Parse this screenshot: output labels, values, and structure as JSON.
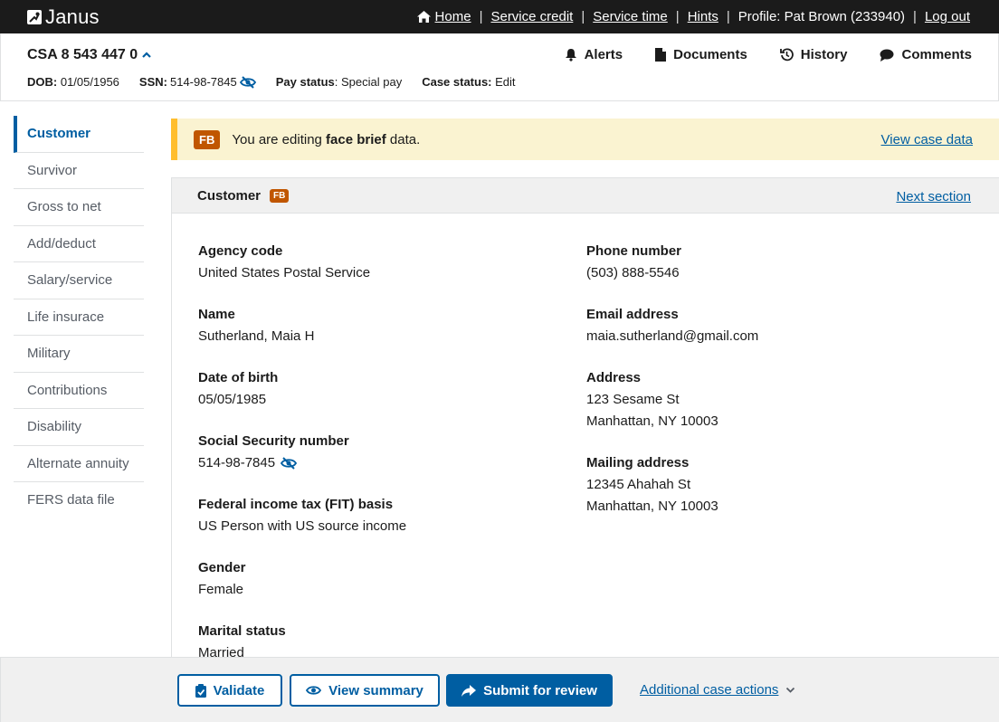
{
  "app": {
    "name": "Janus"
  },
  "topnav": {
    "home": "Home",
    "service_credit": "Service credit",
    "service_time": "Service time",
    "hints": "Hints",
    "profile": "Profile: Pat Brown (233940)",
    "logout": "Log out"
  },
  "case": {
    "id": "CSA 8 543 447 0",
    "dob_label": "DOB:",
    "dob": "01/05/1956",
    "ssn_label": "SSN:",
    "ssn": "514-98-7845",
    "pay_label": "Pay status",
    "pay": ": Special pay",
    "status_label": "Case status:",
    "status": "Edit",
    "actions": {
      "alerts": "Alerts",
      "documents": "Documents",
      "history": "History",
      "comments": "Comments"
    }
  },
  "sidebar": {
    "items": [
      {
        "label": "Customer"
      },
      {
        "label": "Survivor"
      },
      {
        "label": "Gross to net"
      },
      {
        "label": "Add/deduct"
      },
      {
        "label": "Salary/service"
      },
      {
        "label": "Life insurace"
      },
      {
        "label": "Military"
      },
      {
        "label": "Contributions"
      },
      {
        "label": "Disability"
      },
      {
        "label": "Alternate annuity"
      },
      {
        "label": "FERS data file"
      }
    ]
  },
  "banner": {
    "tag": "FB",
    "text_pre": "You are editing ",
    "text_bold": "face brief",
    "text_post": " data.",
    "link": "View case data"
  },
  "section": {
    "title": "Customer",
    "tag": "FB",
    "next": "Next section",
    "fields": {
      "agency": {
        "label": "Agency code",
        "value": "United States Postal Service"
      },
      "name": {
        "label": "Name",
        "value": "Sutherland, Maia H"
      },
      "dob": {
        "label": "Date of birth",
        "value": "05/05/1985"
      },
      "ssn": {
        "label": "Social Security number",
        "value": "514-98-7845"
      },
      "fit": {
        "label": "Federal income tax (FIT) basis",
        "value": "US Person with US source income"
      },
      "gender": {
        "label": "Gender",
        "value": "Female"
      },
      "marital": {
        "label": "Marital status",
        "value": "Married"
      },
      "phone": {
        "label": "Phone number",
        "value": "(503) 888-5546"
      },
      "email": {
        "label": "Email address",
        "value": "maia.sutherland@gmail.com"
      },
      "address": {
        "label": "Address",
        "line1": "123 Sesame St",
        "line2": "Manhattan, NY 10003"
      },
      "mailing": {
        "label": "Mailing address",
        "line1": "12345 Ahahah St",
        "line2": "Manhattan, NY 10003"
      }
    }
  },
  "footer": {
    "validate": "Validate",
    "view_summary": "View summary",
    "submit": "Submit for review",
    "more": "Additional case actions"
  },
  "colors": {
    "primary": "#005ea2",
    "banner_bg": "#faf3d1",
    "banner_accent": "#ffbe2e",
    "tag": "#c05600",
    "topbar": "#1b1b1b"
  }
}
